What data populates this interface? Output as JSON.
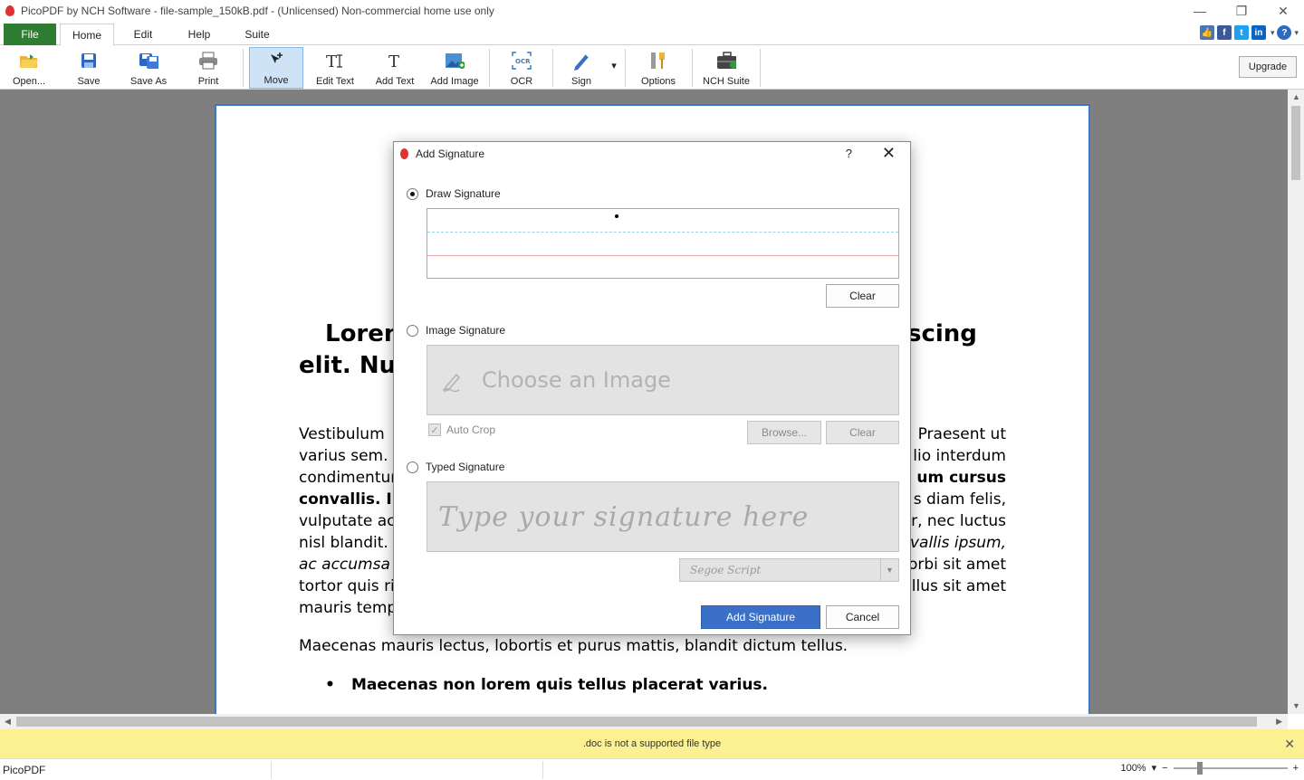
{
  "window": {
    "title": "PicoPDF by NCH Software - file-sample_150kB.pdf - (Unlicensed) Non-commercial home use only",
    "minimize": "—",
    "restore": "❐",
    "close": "✕"
  },
  "menu": {
    "tabs": [
      "File",
      "Home",
      "Edit",
      "Help",
      "Suite"
    ]
  },
  "toolbar": {
    "items": [
      "Open...",
      "Save",
      "Save As",
      "Print",
      "Move",
      "Edit Text",
      "Add Text",
      "Add Image",
      "OCR",
      "Sign",
      "Options",
      "NCH Suite"
    ],
    "upgrade": "Upgrade",
    "sign_caret": "▾"
  },
  "document": {
    "heading_line1_left": "Loren",
    "heading_line1_right": "scing",
    "heading_line2_left": "elit. Nu",
    "para_left": [
      "Vestibulum",
      "varius sem.",
      "condimentur",
      "convallis. I",
      "vulputate ac",
      "nisl blandit.",
      "ac accumsa",
      "tortor quis ri",
      "mauris temp"
    ],
    "para_right": [
      "Praesent ut",
      "lio interdum",
      "um  cursus",
      "s diam felis,",
      "r, nec luctus",
      "vallis ipsum,",
      "orbi sit amet",
      "llus sit amet"
    ],
    "para2": "Maecenas mauris lectus, lobortis et purus mattis, blandit dictum tellus.",
    "bullet": "Maecenas non lorem quis tellus placerat varius."
  },
  "notice": {
    "text": ".doc is not a supported file type",
    "close": "✕"
  },
  "status": {
    "app": "PicoPDF",
    "zoom": "100%",
    "zoom_caret": "▾",
    "zoom_minus": "−",
    "zoom_plus": "+"
  },
  "dialog": {
    "title": "Add Signature",
    "help": "?",
    "close": "✕",
    "draw_label": "Draw Signature",
    "clear_label": "Clear",
    "image_label": "Image Signature",
    "image_placeholder": "Choose an Image",
    "auto_crop": "Auto Crop",
    "auto_crop_mark": "✓",
    "browse_label": "Browse...",
    "clear2_label": "Clear",
    "typed_label": "Typed Signature",
    "typed_placeholder": "Type your signature here",
    "font_value": "Segoe Script",
    "font_caret": "▼",
    "add_label": "Add Signature",
    "cancel_label": "Cancel"
  },
  "colors": {
    "file_tab": "#2e7d32",
    "accent": "#3a70c8",
    "notice": "#fbf193",
    "workspace": "#7f7f7f"
  }
}
